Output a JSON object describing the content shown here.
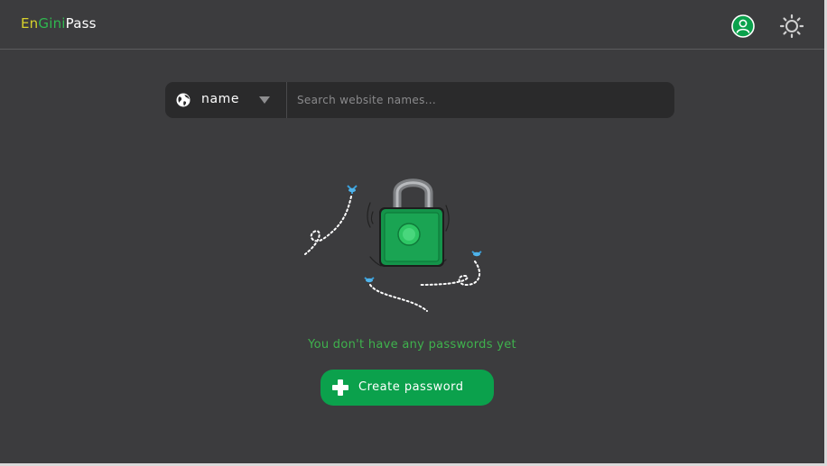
{
  "header": {
    "logo_parts": [
      "En",
      "Gini",
      "Pass"
    ],
    "icons": {
      "profile": "user-circle-icon",
      "theme": "sun-icon"
    }
  },
  "search": {
    "selector_label": "name",
    "placeholder": "Search website names..."
  },
  "empty_state": {
    "message": "You don't have any passwords yet",
    "create_button_label": "Create password"
  },
  "colors": {
    "background": "#3c3c3e",
    "accent_green": "#0ba14c",
    "message_green": "#3fb24d",
    "logo_en": "#d8d22c",
    "logo_gini": "#2fb84f"
  }
}
